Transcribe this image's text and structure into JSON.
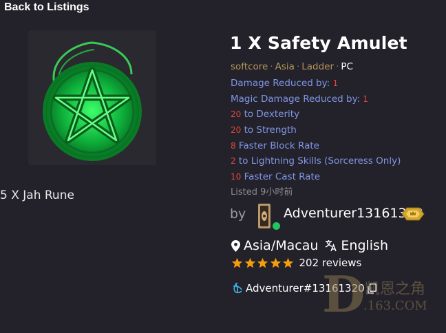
{
  "nav": {
    "back_label": "Back to Listings"
  },
  "item": {
    "title": "1 X Safety Amulet",
    "image_icon": "green-pentagram-amulet",
    "meta": {
      "mode": "softcore",
      "region": "Asia",
      "ladder": "Ladder",
      "platform": "PC"
    },
    "stats": [
      {
        "label": "Damage Reduced by: ",
        "value": "1"
      },
      {
        "label": "Magic Damage Reduced by: ",
        "value": "1"
      },
      {
        "value": "20",
        "label": " to Dexterity"
      },
      {
        "value": "20",
        "label": " to Strength"
      },
      {
        "value": "8",
        "label": " Faster Block Rate"
      },
      {
        "value": "2",
        "label": " to Lightning Skills (Sorceress Only)"
      },
      {
        "value": "10",
        "label": " Faster Cast Rate"
      }
    ],
    "listed": "Listed 9小时前"
  },
  "price": {
    "label": "5 X Jah Rune"
  },
  "seller": {
    "by_label": "by",
    "name": "Adventurer13161320",
    "online": true,
    "location": "Asia/Macau",
    "language": "English",
    "rating_stars": 5,
    "reviews": "202 reviews",
    "battletag": "Adventurer#13161320"
  },
  "watermark": {
    "cn": "凯恩之角",
    "url": ".163.COM",
    "letter": "D"
  },
  "colors": {
    "background": "#23222a",
    "stat_label": "#7f96e6",
    "stat_value": "#e0473c",
    "meta_tag": "#b3945a",
    "star": "#f59e0b",
    "online": "#22c55e"
  }
}
